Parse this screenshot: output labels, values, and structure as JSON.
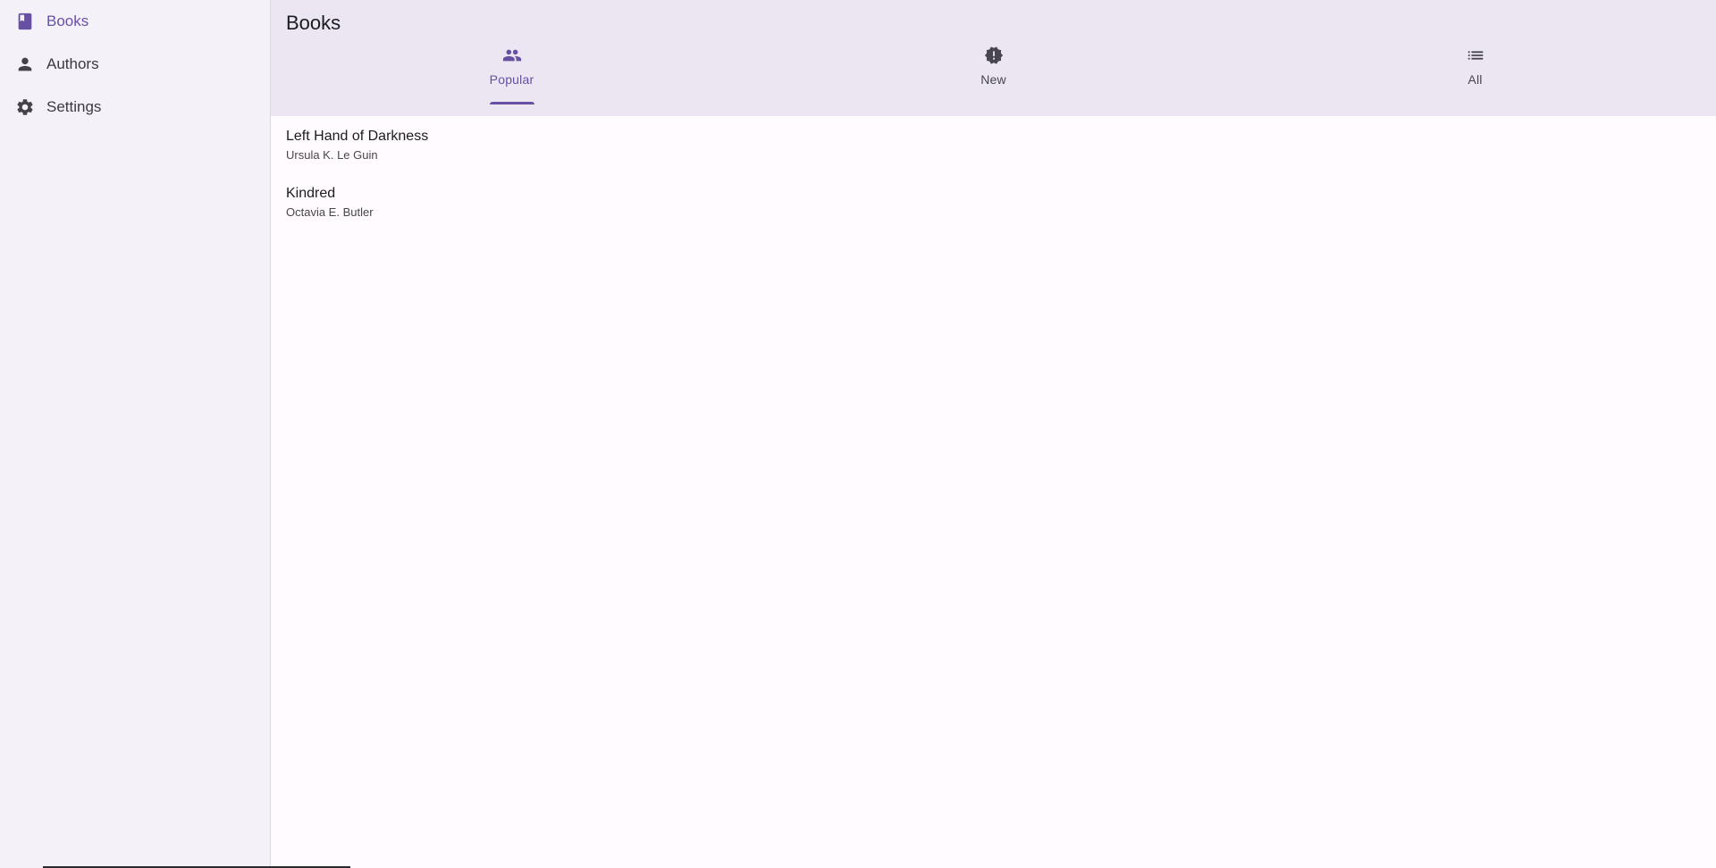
{
  "sidebar": {
    "items": [
      {
        "label": "Books",
        "icon": "book-icon",
        "active": true
      },
      {
        "label": "Authors",
        "icon": "person-icon",
        "active": false
      },
      {
        "label": "Settings",
        "icon": "gear-icon",
        "active": false
      }
    ]
  },
  "header": {
    "title": "Books"
  },
  "tabs": [
    {
      "label": "Popular",
      "icon": "people-icon",
      "active": true
    },
    {
      "label": "New",
      "icon": "new-releases-icon",
      "active": false
    },
    {
      "label": "All",
      "icon": "list-icon",
      "active": false
    }
  ],
  "books": [
    {
      "title": "Left Hand of Darkness",
      "author": "Ursula K. Le Guin"
    },
    {
      "title": "Kindred",
      "author": "Octavia E. Butler"
    }
  ],
  "colors": {
    "accent": "#6750a4",
    "sidebar_bg": "#f5f1f8",
    "appbar_bg": "#ebe6f1",
    "page_bg": "#fffbfe"
  }
}
